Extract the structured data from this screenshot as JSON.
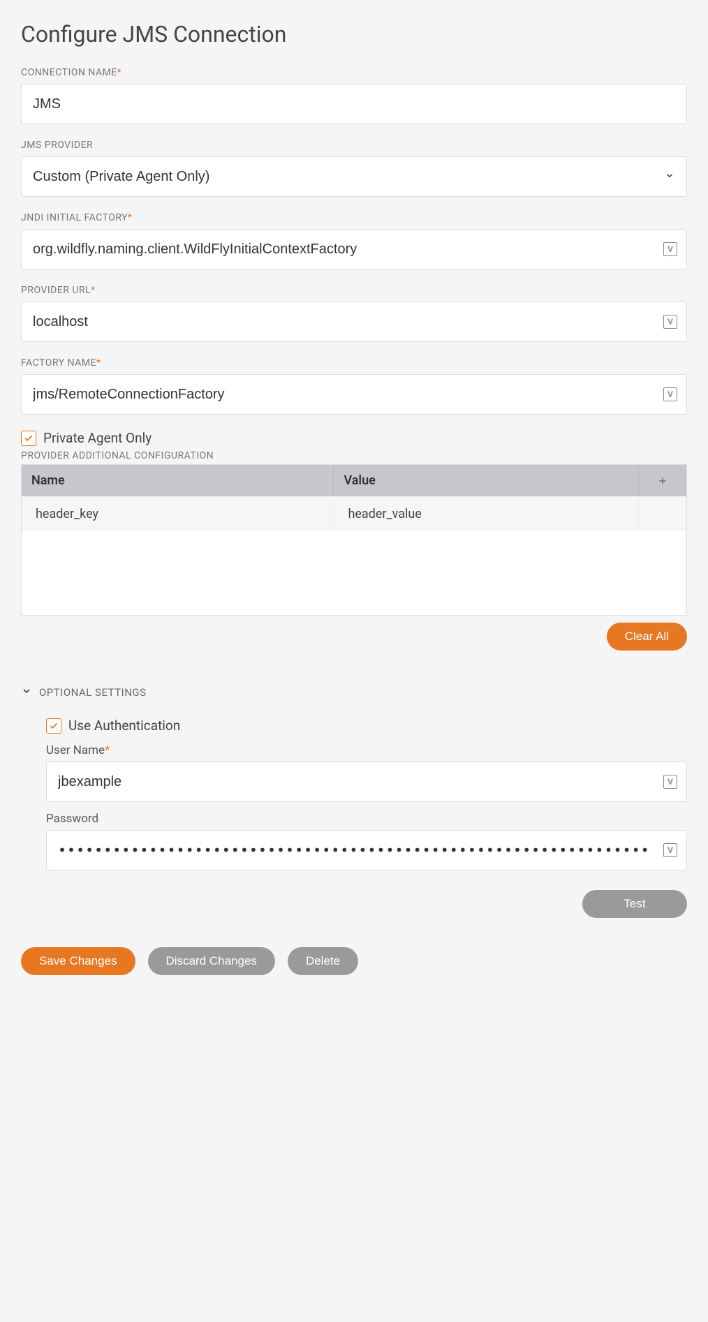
{
  "title": "Configure JMS Connection",
  "fields": {
    "connection_name": {
      "label": "CONNECTION NAME",
      "value": "JMS",
      "required": true
    },
    "jms_provider": {
      "label": "JMS PROVIDER",
      "value": "Custom (Private Agent Only)",
      "required": false
    },
    "jndi_initial_factory": {
      "label": "JNDI INITIAL FACTORY",
      "value": "org.wildfly.naming.client.WildFlyInitialContextFactory",
      "required": true
    },
    "provider_url": {
      "label": "PROVIDER URL",
      "value": "localhost",
      "required": true
    },
    "factory_name": {
      "label": "FACTORY NAME",
      "value": "jms/RemoteConnectionFactory",
      "required": true
    }
  },
  "private_agent_only": {
    "label": "Private Agent Only",
    "checked": true
  },
  "additional_config": {
    "label": "PROVIDER ADDITIONAL CONFIGURATION",
    "columns": {
      "name": "Name",
      "value": "Value"
    },
    "rows": [
      {
        "name": "header_key",
        "value": "header_value"
      }
    ]
  },
  "clear_all_label": "Clear All",
  "optional": {
    "title": "OPTIONAL SETTINGS",
    "expanded": true,
    "use_auth": {
      "label": "Use Authentication",
      "checked": true
    },
    "username": {
      "label": "User Name",
      "value": "jbexample",
      "required": true
    },
    "password": {
      "label": "Password",
      "value": "•••••••••••••••••••••••••••••••••••••••••••••••••••••••••••••••••"
    },
    "test_label": "Test"
  },
  "actions": {
    "save": "Save Changes",
    "discard": "Discard Changes",
    "delete": "Delete"
  },
  "required_marker": "*"
}
